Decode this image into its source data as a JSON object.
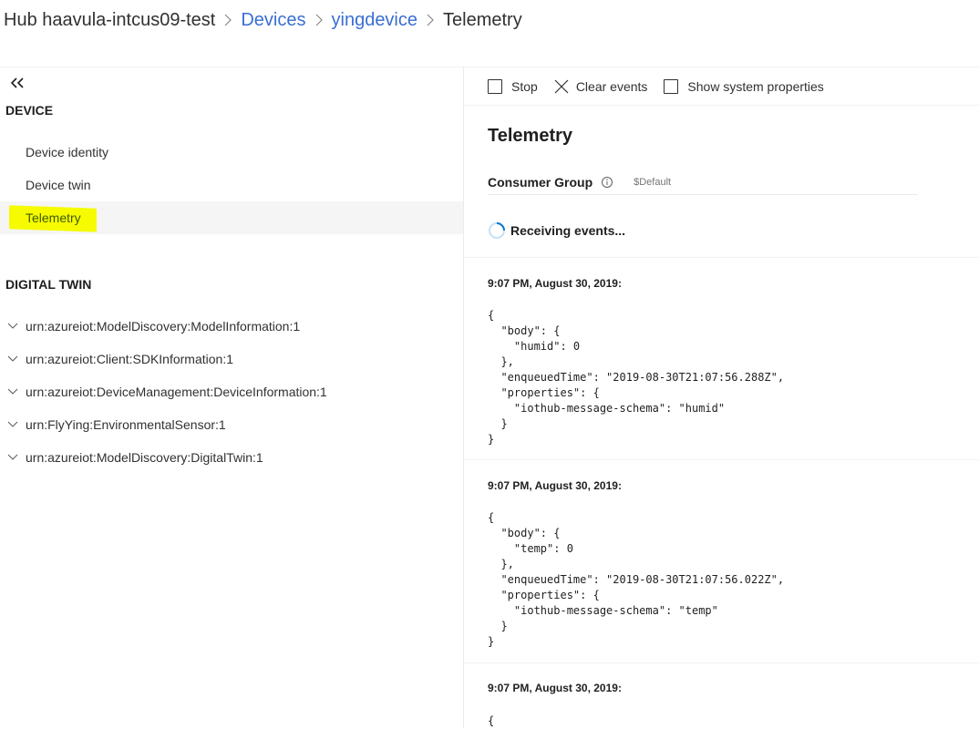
{
  "breadcrumb": {
    "hub": "Hub haavula-intcus09-test",
    "devices": "Devices",
    "device": "yingdevice",
    "current": "Telemetry"
  },
  "nav": {
    "collapse_icon": "double-chevron-left-icon",
    "device_group": {
      "title": "DEVICE",
      "items": [
        "Device identity",
        "Device twin",
        "Telemetry"
      ],
      "selected": "Telemetry",
      "highlight_color": "#f6fb00"
    },
    "digital_twin_group": {
      "title": "DIGITAL TWIN",
      "items": [
        "urn:azureiot:ModelDiscovery:ModelInformation:1",
        "urn:azureiot:Client:SDKInformation:1",
        "urn:azureiot:DeviceManagement:DeviceInformation:1",
        "urn:FlyYing:EnvironmentalSensor:1",
        "urn:azureiot:ModelDiscovery:DigitalTwin:1"
      ]
    }
  },
  "commands": {
    "stop": "Stop",
    "clear_events": "Clear events",
    "show_system_properties": "Show system properties"
  },
  "telemetry": {
    "title": "Telemetry",
    "consumer_group_label": "Consumer Group",
    "consumer_group_placeholder": "$Default",
    "status": "Receiving events...",
    "spinner_color": "#0078d4"
  },
  "events": [
    {
      "time": "9:07 PM, August 30, 2019:",
      "body": "{\n  \"body\": {\n    \"humid\": 0\n  },\n  \"enqueuedTime\": \"2019-08-30T21:07:56.288Z\",\n  \"properties\": {\n    \"iothub-message-schema\": \"humid\"\n  }\n}"
    },
    {
      "time": "9:07 PM, August 30, 2019:",
      "body": "{\n  \"body\": {\n    \"temp\": 0\n  },\n  \"enqueuedTime\": \"2019-08-30T21:07:56.022Z\",\n  \"properties\": {\n    \"iothub-message-schema\": \"temp\"\n  }\n}"
    },
    {
      "time": "9:07 PM, August 30, 2019:",
      "body": "{"
    }
  ],
  "colors": {
    "link": "#3a6ed3",
    "text": "#323130",
    "selected_bg": "#f5f5f5"
  }
}
